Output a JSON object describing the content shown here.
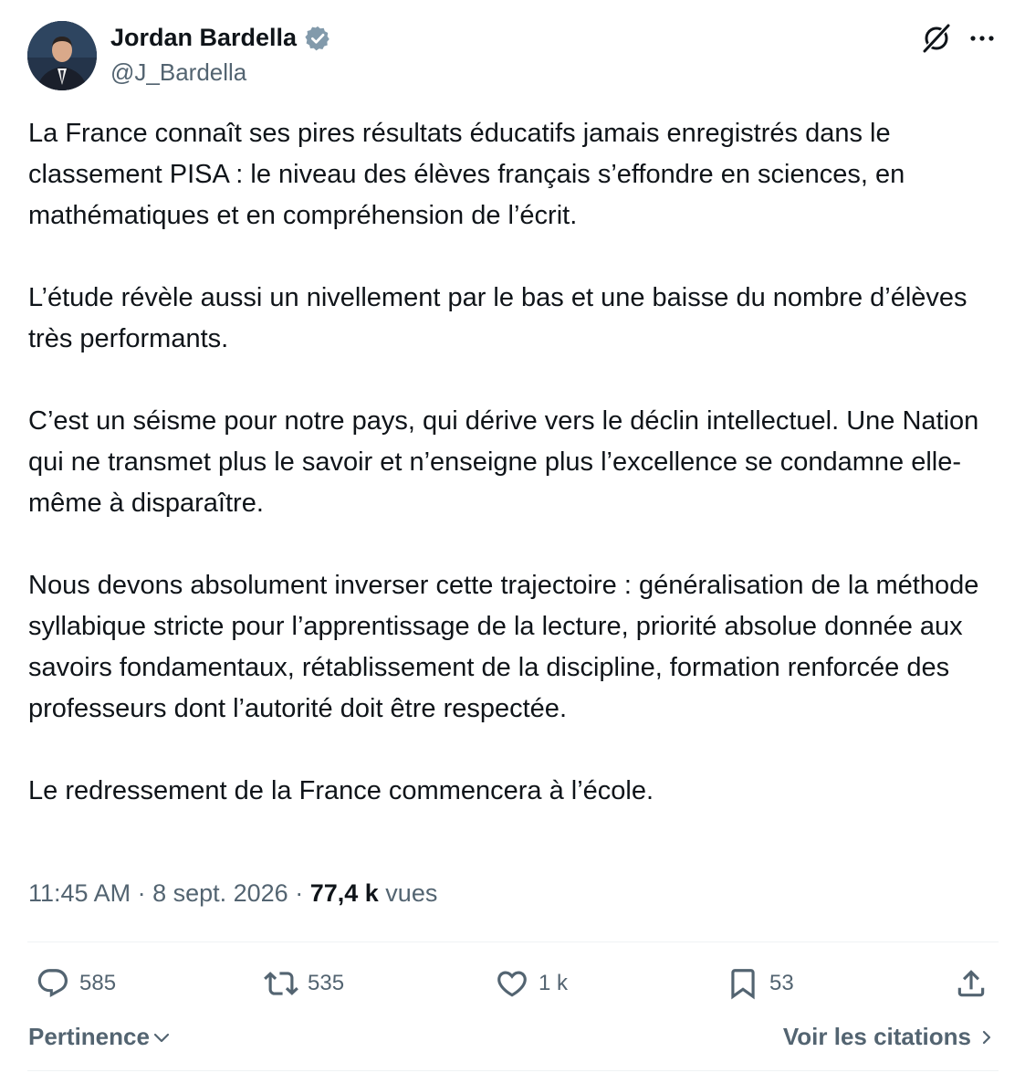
{
  "author": {
    "name": "Jordan Bardella",
    "handle": "@J_Bardella",
    "verified_color": "#829aab"
  },
  "header_icons": [
    "grok-icon",
    "more-icon"
  ],
  "tweet": {
    "paragraphs": [
      "La France connaît ses pires résultats éducatifs jamais enregistrés dans le classement PISA : le niveau des élèves français s’effondre en sciences, en mathématiques et en compréhension de l’écrit.",
      "L’étude révèle aussi un nivellement par le bas et une baisse du nombre d’élèves très performants.",
      "C’est un séisme pour notre pays, qui dérive vers le déclin intellectuel. Une Nation qui ne transmet plus le savoir et n’enseigne plus l’excellence se condamne elle-même à disparaître.",
      "Nous devons absolument inverser cette trajectoire : généralisation de la méthode syllabique stricte pour l’apprentissage de la lecture, priorité absolue donnée aux savoirs fondamentaux, rétablissement de la discipline, formation renforcée des professeurs dont l’autorité doit être respectée.",
      "Le redressement de la France commencera à l’école."
    ]
  },
  "meta": {
    "time": "11:45 AM",
    "separator": " · ",
    "date": "8 sept. 2026",
    "views_count": "77,4 k",
    "views_label": "vues"
  },
  "actions": {
    "replies": "585",
    "reposts": "535",
    "likes": "1 k",
    "bookmarks": "53"
  },
  "footer": {
    "sort_label": "Pertinence",
    "quotes_label": "Voir les citations"
  },
  "colors": {
    "text": "#0f1419",
    "secondary": "#536471",
    "divider": "#eff3f4"
  }
}
